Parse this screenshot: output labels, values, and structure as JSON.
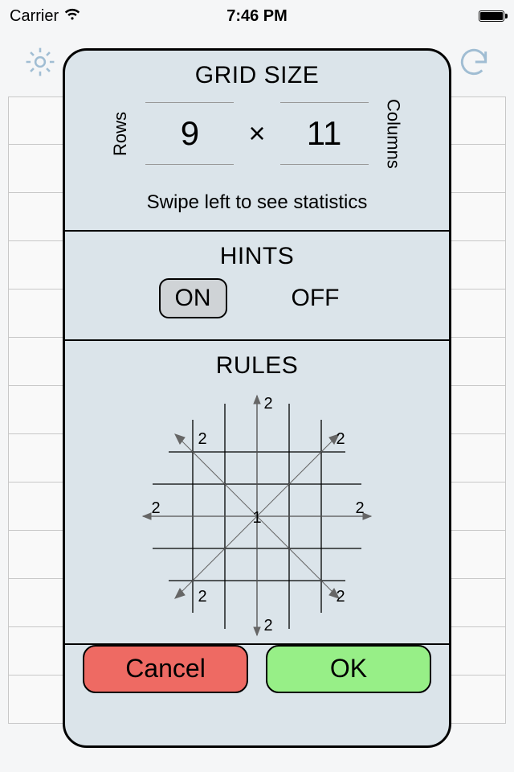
{
  "status": {
    "carrier": "Carrier",
    "time": "7:46 PM"
  },
  "modal": {
    "grid_size": {
      "title": "GRID SIZE",
      "rows_label": "Rows",
      "columns_label": "Columns",
      "rows_value": "9",
      "columns_value": "11",
      "separator": "×",
      "hint": "Swipe left to see statistics"
    },
    "hints": {
      "title": "HINTS",
      "on_label": "ON",
      "off_label": "OFF",
      "selected": "on"
    },
    "rules": {
      "title": "RULES",
      "center": "1",
      "outer": "2"
    },
    "buttons": {
      "cancel": "Cancel",
      "ok": "OK"
    }
  }
}
